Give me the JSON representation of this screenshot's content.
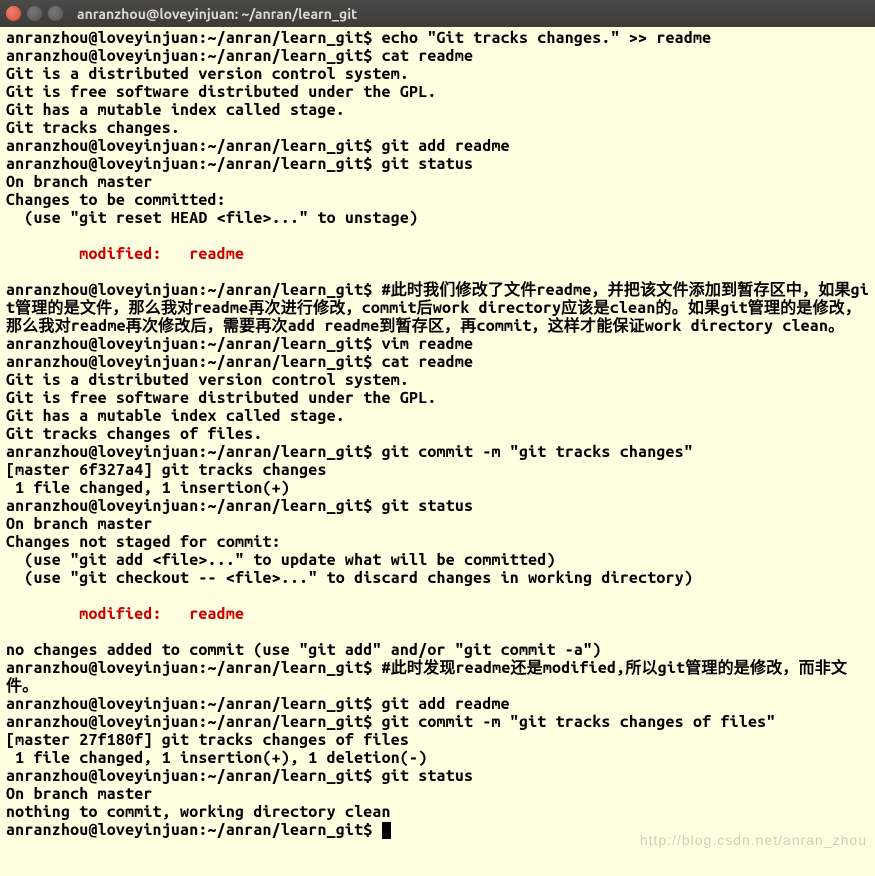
{
  "window": {
    "title": "anranzhou@loveyinjuan: ~/anran/learn_git"
  },
  "prompt": "anranzhou@loveyinjuan:~/anran/learn_git$ ",
  "lines": [
    {
      "type": "cmd",
      "text": "echo \"Git tracks changes.\" >> readme"
    },
    {
      "type": "cmd",
      "text": "cat readme"
    },
    {
      "type": "out",
      "text": "Git is a distributed version control system."
    },
    {
      "type": "out",
      "text": "Git is free software distributed under the GPL."
    },
    {
      "type": "out",
      "text": "Git has a mutable index called stage."
    },
    {
      "type": "out",
      "text": "Git tracks changes."
    },
    {
      "type": "cmd",
      "text": "git add readme"
    },
    {
      "type": "cmd",
      "text": "git status"
    },
    {
      "type": "out",
      "text": "On branch master"
    },
    {
      "type": "out",
      "text": "Changes to be committed:"
    },
    {
      "type": "out",
      "text": "  (use \"git reset HEAD <file>...\" to unstage)"
    },
    {
      "type": "blank"
    },
    {
      "type": "status",
      "label": "modified:",
      "file": "readme"
    },
    {
      "type": "blank"
    },
    {
      "type": "cmd",
      "text": "#此时我们修改了文件readme，并把该文件添加到暂存区中，如果git管理的是文件，那么我对readme再次进行修改，commit后work directory应该是clean的。如果git管理的是修改，那么我对readme再次修改后，需要再次add readme到暂存区，再commit，这样才能保证work directory clean。"
    },
    {
      "type": "cmd",
      "text": "vim readme"
    },
    {
      "type": "cmd",
      "text": "cat readme"
    },
    {
      "type": "out",
      "text": "Git is a distributed version control system."
    },
    {
      "type": "out",
      "text": "Git is free software distributed under the GPL."
    },
    {
      "type": "out",
      "text": "Git has a mutable index called stage."
    },
    {
      "type": "out",
      "text": "Git tracks changes of files."
    },
    {
      "type": "cmd",
      "text": "git commit -m \"git tracks changes\""
    },
    {
      "type": "out",
      "text": "[master 6f327a4] git tracks changes"
    },
    {
      "type": "out",
      "text": " 1 file changed, 1 insertion(+)"
    },
    {
      "type": "cmd",
      "text": "git status"
    },
    {
      "type": "out",
      "text": "On branch master"
    },
    {
      "type": "out",
      "text": "Changes not staged for commit:"
    },
    {
      "type": "out",
      "text": "  (use \"git add <file>...\" to update what will be committed)"
    },
    {
      "type": "out",
      "text": "  (use \"git checkout -- <file>...\" to discard changes in working directory)"
    },
    {
      "type": "blank"
    },
    {
      "type": "status",
      "label": "modified:",
      "file": "readme"
    },
    {
      "type": "blank"
    },
    {
      "type": "out",
      "text": "no changes added to commit (use \"git add\" and/or \"git commit -a\")"
    },
    {
      "type": "cmd",
      "text": "#此时发现readme还是modified,所以git管理的是修改，而非文件。"
    },
    {
      "type": "cmd",
      "text": "git add readme"
    },
    {
      "type": "cmd",
      "text": "git commit -m \"git tracks changes of files\""
    },
    {
      "type": "out",
      "text": "[master 27f180f] git tracks changes of files"
    },
    {
      "type": "out",
      "text": " 1 file changed, 1 insertion(+), 1 deletion(-)"
    },
    {
      "type": "cmd",
      "text": "git status"
    },
    {
      "type": "out",
      "text": "On branch master"
    },
    {
      "type": "out",
      "text": "nothing to commit, working directory clean"
    },
    {
      "type": "cmd-cursor",
      "text": ""
    }
  ],
  "watermark": "http://blog.csdn.net/anran_zhou"
}
